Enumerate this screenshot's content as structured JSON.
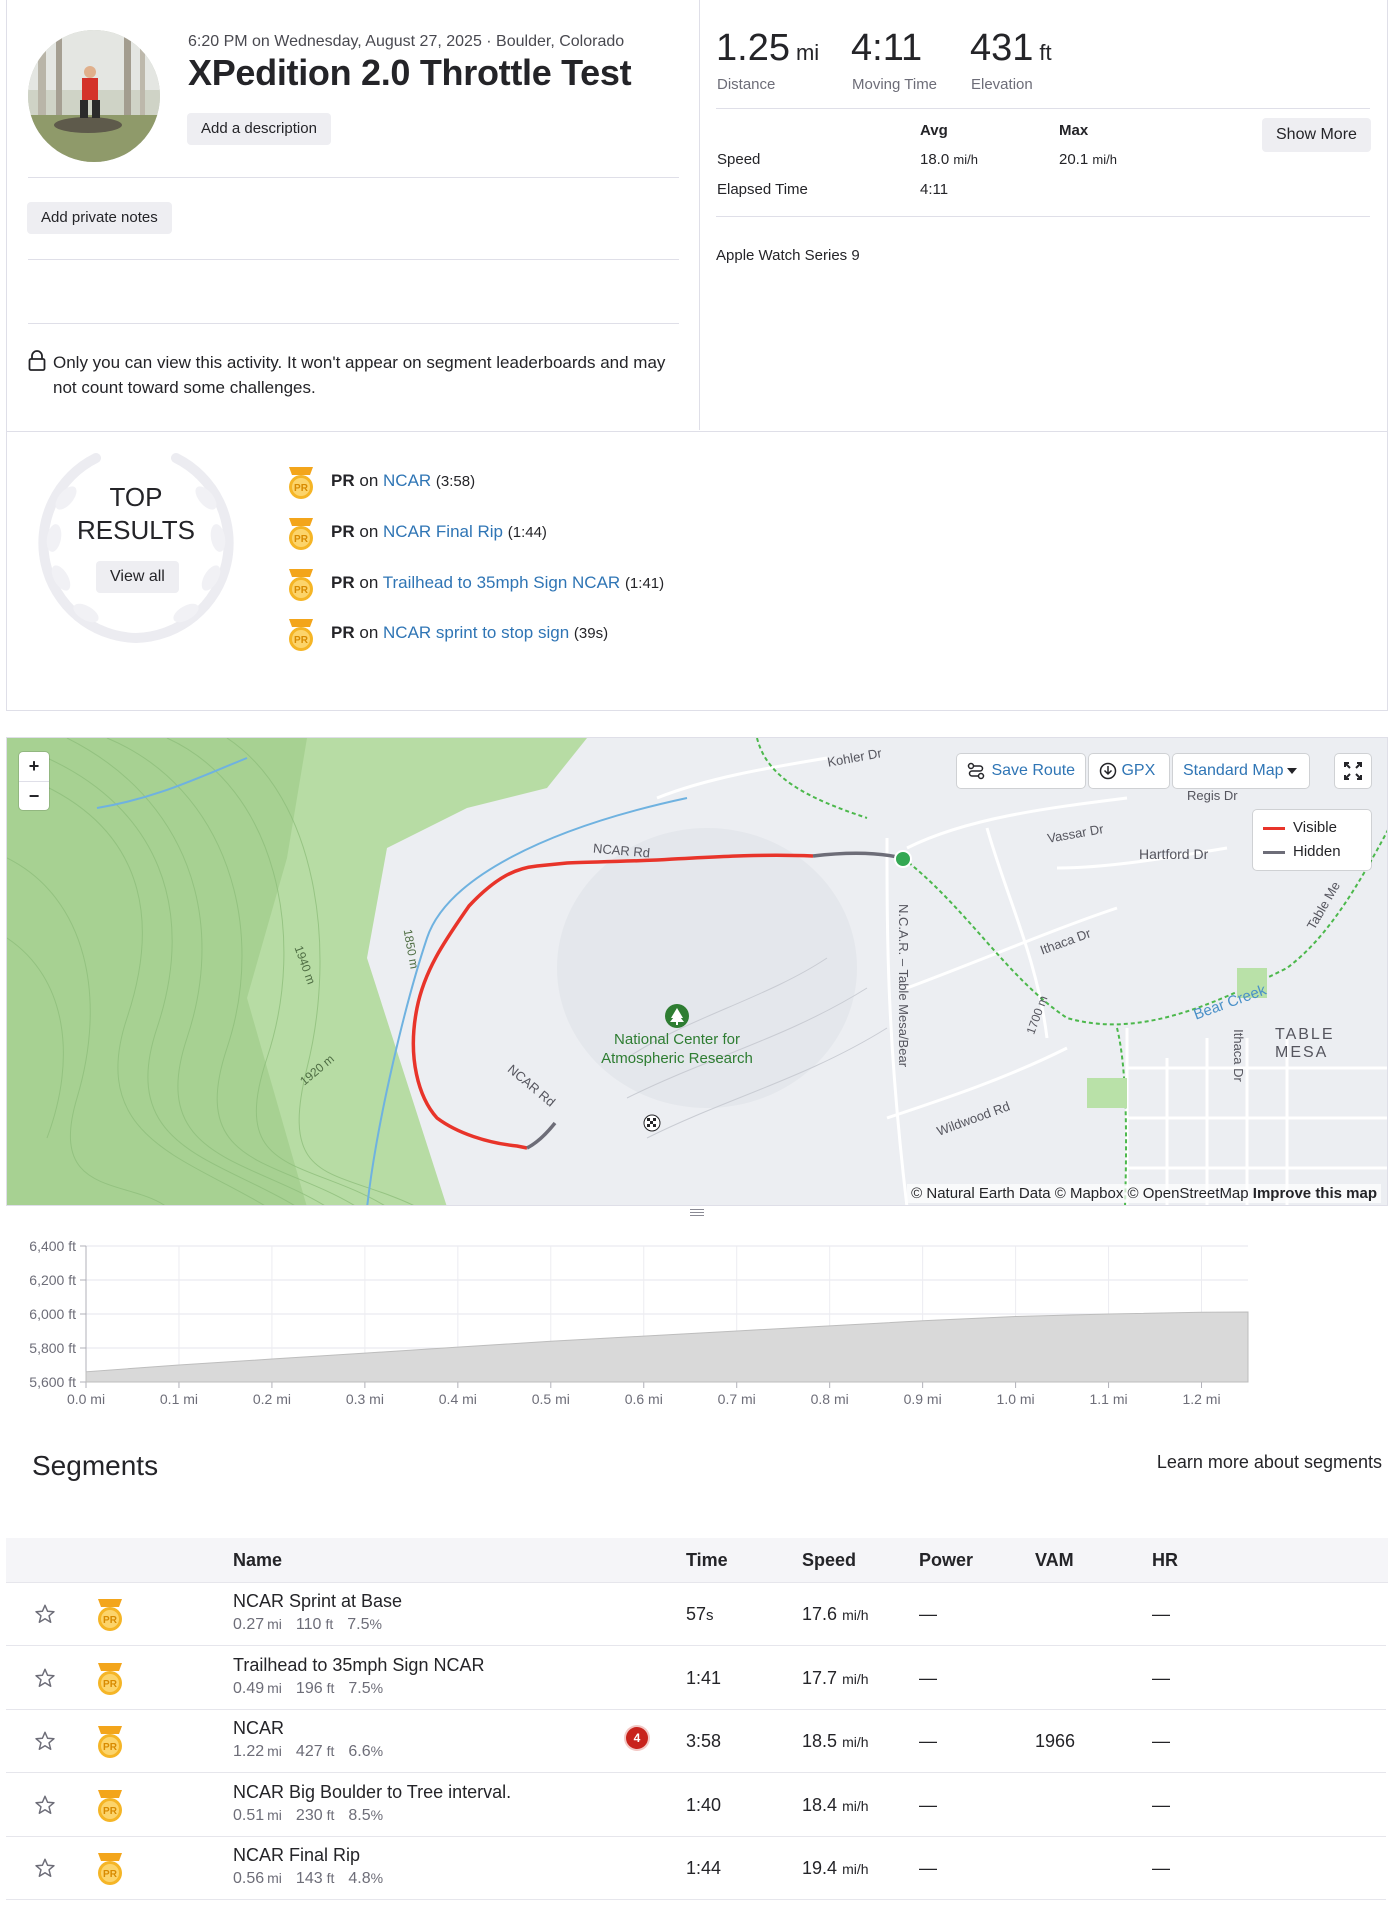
{
  "activity": {
    "meta": "6:20 PM on Wednesday, August 27, 2025 · Boulder, Colorado",
    "title": "XPedition 2.0 Throttle Test",
    "add_description": "Add a description",
    "add_private_notes": "Add private notes",
    "privacy_notice": "Only you can view this activity. It won't appear on segment leaderboards and may not count toward some challenges."
  },
  "stats": {
    "distance": {
      "value": "1.25",
      "unit": "mi",
      "label": "Distance"
    },
    "moving_time": {
      "value": "4:11",
      "label": "Moving Time"
    },
    "elevation": {
      "value": "431",
      "unit": "ft",
      "label": "Elevation"
    },
    "table": {
      "avg_header": "Avg",
      "max_header": "Max",
      "rows": [
        {
          "label": "Speed",
          "avg": "18.0",
          "avg_unit": "mi/h",
          "max": "20.1",
          "max_unit": "mi/h"
        },
        {
          "label": "Elapsed Time",
          "avg": "4:11"
        }
      ]
    },
    "show_more": "Show More",
    "device": "Apple Watch Series 9"
  },
  "top_results": {
    "title_line1": "TOP",
    "title_line2": "RESULTS",
    "view_all": "View all",
    "items": [
      {
        "badge": "PR",
        "on": "on",
        "segment": "NCAR",
        "time": "(3:58)"
      },
      {
        "badge": "PR",
        "on": "on",
        "segment": "NCAR Final Rip",
        "time": "(1:44)"
      },
      {
        "badge": "PR",
        "on": "on",
        "segment": "Trailhead to 35mph Sign NCAR",
        "time": "(1:41)"
      },
      {
        "badge": "PR",
        "on": "on",
        "segment": "NCAR sprint to stop sign",
        "time": "(39s)"
      }
    ]
  },
  "map": {
    "zoom_in": "+",
    "zoom_out": "−",
    "save_route": "Save Route",
    "gpx": "GPX",
    "map_style": "Standard Map",
    "legend": {
      "visible": "Visible",
      "hidden": "Hidden"
    },
    "attribution": "© Natural Earth Data © Mapbox © OpenStreetMap",
    "improve": "Improve this map",
    "labels": {
      "kohler": "Kohler Dr",
      "regis": "Regis Dr",
      "vassar": "Vassar Dr",
      "hartford": "Hartford Dr",
      "ncar_rd_top": "NCAR Rd",
      "ncar_rd_bottom": "NCAR Rd",
      "ncar_place_1": "National Center for",
      "ncar_place_2": "Atmospheric Research",
      "table_mesa_bear": "N.C.A.R. – Table Mesa/Bear",
      "ithaca": "Ithaca Dr",
      "bear_creek": "Bear Creek",
      "table_mesa_area": "TABLE MESA",
      "wildwood": "Wildwood Rd",
      "ithaca_v": "Ithaca Dr",
      "table_me": "Table Me",
      "c1940": "1940 m",
      "c1850": "1850 m",
      "c1920": "1920 m",
      "c1700": "1700 m"
    },
    "colors": {
      "visible": "#e8342a",
      "hidden": "#6d6d78",
      "start": "#34a853"
    }
  },
  "chart_data": {
    "type": "area",
    "title": "",
    "xlabel": "",
    "ylabel": "",
    "xlim": [
      0,
      1.25
    ],
    "ylim": [
      5600,
      6400
    ],
    "x_ticks": [
      "0.0 mi",
      "0.1 mi",
      "0.2 mi",
      "0.3 mi",
      "0.4 mi",
      "0.5 mi",
      "0.6 mi",
      "0.7 mi",
      "0.8 mi",
      "0.9 mi",
      "1.0 mi",
      "1.1 mi",
      "1.2 mi"
    ],
    "y_ticks": [
      "6,400 ft",
      "6,200 ft",
      "6,000 ft",
      "5,800 ft",
      "5,600 ft"
    ],
    "x": [
      0,
      0.1,
      0.2,
      0.3,
      0.4,
      0.5,
      0.6,
      0.7,
      0.8,
      0.85,
      0.9,
      1.0,
      1.1,
      1.2,
      1.25
    ],
    "y": [
      5660,
      5700,
      5735,
      5770,
      5805,
      5840,
      5870,
      5900,
      5930,
      5945,
      5960,
      5985,
      6000,
      6010,
      6012
    ],
    "grid": true,
    "fill_color": "#d9d9d9"
  },
  "segments": {
    "title": "Segments",
    "learn_more": "Learn more about segments",
    "headers": {
      "name": "Name",
      "time": "Time",
      "speed": "Speed",
      "power": "Power",
      "vam": "VAM",
      "hr": "HR"
    },
    "rows": [
      {
        "name": "NCAR Sprint at Base",
        "dist": "0.27",
        "dist_unit": "mi",
        "elev": "110",
        "elev_unit": "ft",
        "grade": "7.5",
        "grade_unit": "%",
        "badge": "PR",
        "rank": "",
        "time": "57",
        "time_unit": "s",
        "speed": "17.6",
        "speed_unit": "mi/h",
        "power": "—",
        "vam": "",
        "hr": "—"
      },
      {
        "name": "Trailhead to 35mph Sign NCAR",
        "dist": "0.49",
        "dist_unit": "mi",
        "elev": "196",
        "elev_unit": "ft",
        "grade": "7.5",
        "grade_unit": "%",
        "badge": "PR",
        "rank": "",
        "time": "1:41",
        "time_unit": "",
        "speed": "17.7",
        "speed_unit": "mi/h",
        "power": "—",
        "vam": "",
        "hr": "—"
      },
      {
        "name": "NCAR",
        "dist": "1.22",
        "dist_unit": "mi",
        "elev": "427",
        "elev_unit": "ft",
        "grade": "6.6",
        "grade_unit": "%",
        "badge": "PR",
        "rank": "4",
        "time": "3:58",
        "time_unit": "",
        "speed": "18.5",
        "speed_unit": "mi/h",
        "power": "—",
        "vam": "1966",
        "hr": "—"
      },
      {
        "name": "NCAR Big Boulder to Tree interval.",
        "dist": "0.51",
        "dist_unit": "mi",
        "elev": "230",
        "elev_unit": "ft",
        "grade": "8.5",
        "grade_unit": "%",
        "badge": "PR",
        "rank": "",
        "time": "1:40",
        "time_unit": "",
        "speed": "18.4",
        "speed_unit": "mi/h",
        "power": "—",
        "vam": "",
        "hr": "—"
      },
      {
        "name": "NCAR Final Rip",
        "dist": "0.56",
        "dist_unit": "mi",
        "elev": "143",
        "elev_unit": "ft",
        "grade": "4.8",
        "grade_unit": "%",
        "badge": "PR",
        "rank": "",
        "time": "1:44",
        "time_unit": "",
        "speed": "19.4",
        "speed_unit": "mi/h",
        "power": "—",
        "vam": "",
        "hr": "—"
      }
    ]
  }
}
